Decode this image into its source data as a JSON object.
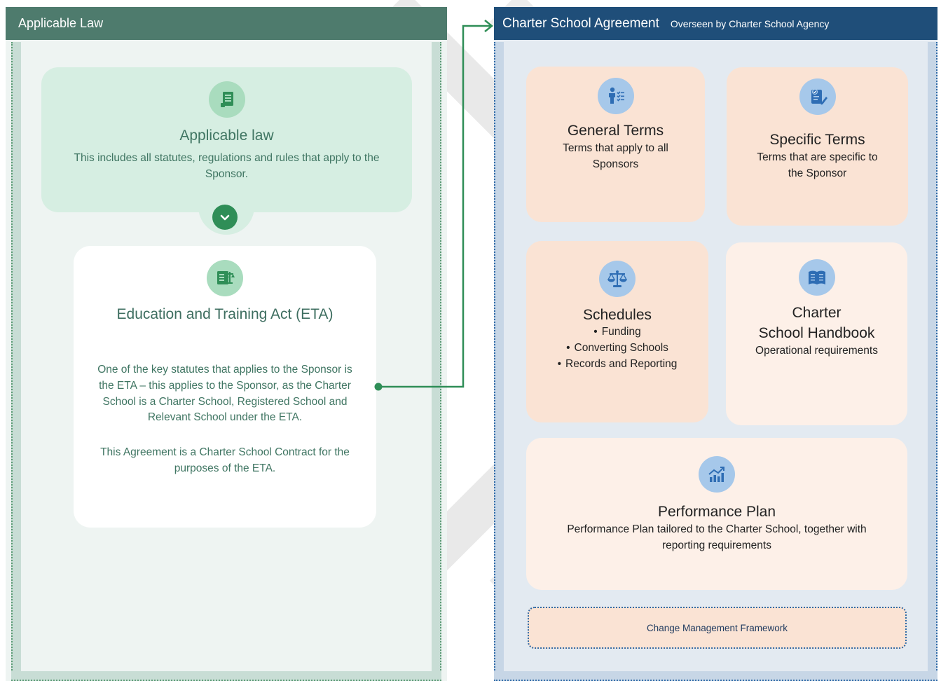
{
  "left_panel": {
    "header": "Applicable Law",
    "law_card": {
      "title": "Applicable law",
      "description": "This includes all statutes, regulations and rules that apply to the Sponsor."
    },
    "eta_card": {
      "title": "Education and Training Act (ETA)",
      "description": "One of the key statutes that applies to the Sponsor is the ETA – this applies to the Sponsor, as the Charter School is a Charter School, Registered School and Relevant School under the ETA.",
      "description2": "This Agreement is a Charter School Contract for the purposes of the ETA."
    }
  },
  "right_panel": {
    "header_title": "Charter School Agreement",
    "header_subtitle": "Overseen by Charter School Agency",
    "general_terms": {
      "title": "General Terms",
      "description": "Terms that apply to all Sponsors"
    },
    "specific_terms": {
      "title": "Specific Terms",
      "description": "Terms that are specific to the Sponsor"
    },
    "schedules": {
      "title": "Schedules",
      "items": [
        "Funding",
        "Converting Schools",
        "Records and Reporting"
      ]
    },
    "handbook": {
      "title_line1": "Charter",
      "title_line2": "School Handbook",
      "description": "Operational requirements"
    },
    "performance_plan": {
      "title": "Performance Plan",
      "description": "Performance Plan tailored to the Charter School, together with reporting requirements"
    },
    "change_management": "Change Management Framework"
  },
  "icons": {
    "law": "document-icon",
    "eta": "legal-scroll-icon",
    "general_terms": "person-checklist-icon",
    "specific_terms": "clipboard-edit-icon",
    "schedules": "scales-icon",
    "handbook": "open-book-icon",
    "performance_plan": "growth-chart-icon",
    "expand": "chevron-down-icon"
  },
  "colors": {
    "left_header": "#4e7b6d",
    "right_header": "#1f4e79",
    "green_accent": "#2f8e57",
    "blue_icon": "#2e6db4",
    "peach": "#fae3d4"
  }
}
